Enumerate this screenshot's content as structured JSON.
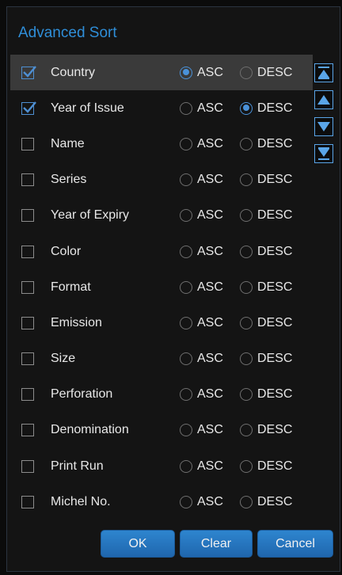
{
  "dialog": {
    "title": "Advanced Sort"
  },
  "asc_label": "ASC",
  "desc_label": "DESC",
  "fields": [
    {
      "label": "Country",
      "checked": true,
      "order": "ASC",
      "selected": true
    },
    {
      "label": "Year of Issue",
      "checked": true,
      "order": "DESC",
      "selected": false
    },
    {
      "label": "Name",
      "checked": false,
      "order": null,
      "selected": false
    },
    {
      "label": "Series",
      "checked": false,
      "order": null,
      "selected": false
    },
    {
      "label": "Year of Expiry",
      "checked": false,
      "order": null,
      "selected": false
    },
    {
      "label": "Color",
      "checked": false,
      "order": null,
      "selected": false
    },
    {
      "label": "Format",
      "checked": false,
      "order": null,
      "selected": false
    },
    {
      "label": "Emission",
      "checked": false,
      "order": null,
      "selected": false
    },
    {
      "label": "Size",
      "checked": false,
      "order": null,
      "selected": false
    },
    {
      "label": "Perforation",
      "checked": false,
      "order": null,
      "selected": false
    },
    {
      "label": "Denomination",
      "checked": false,
      "order": null,
      "selected": false
    },
    {
      "label": "Print Run",
      "checked": false,
      "order": null,
      "selected": false
    },
    {
      "label": "Michel No.",
      "checked": false,
      "order": null,
      "selected": false
    }
  ],
  "move_buttons": [
    "move-to-top-icon",
    "move-up-icon",
    "move-down-icon",
    "move-to-bottom-icon"
  ],
  "buttons": {
    "ok": "OK",
    "clear": "Clear",
    "cancel": "Cancel"
  },
  "colors": {
    "accent": "#2f8ed8",
    "selected_row": "#3a3a3a",
    "background": "#141414"
  }
}
